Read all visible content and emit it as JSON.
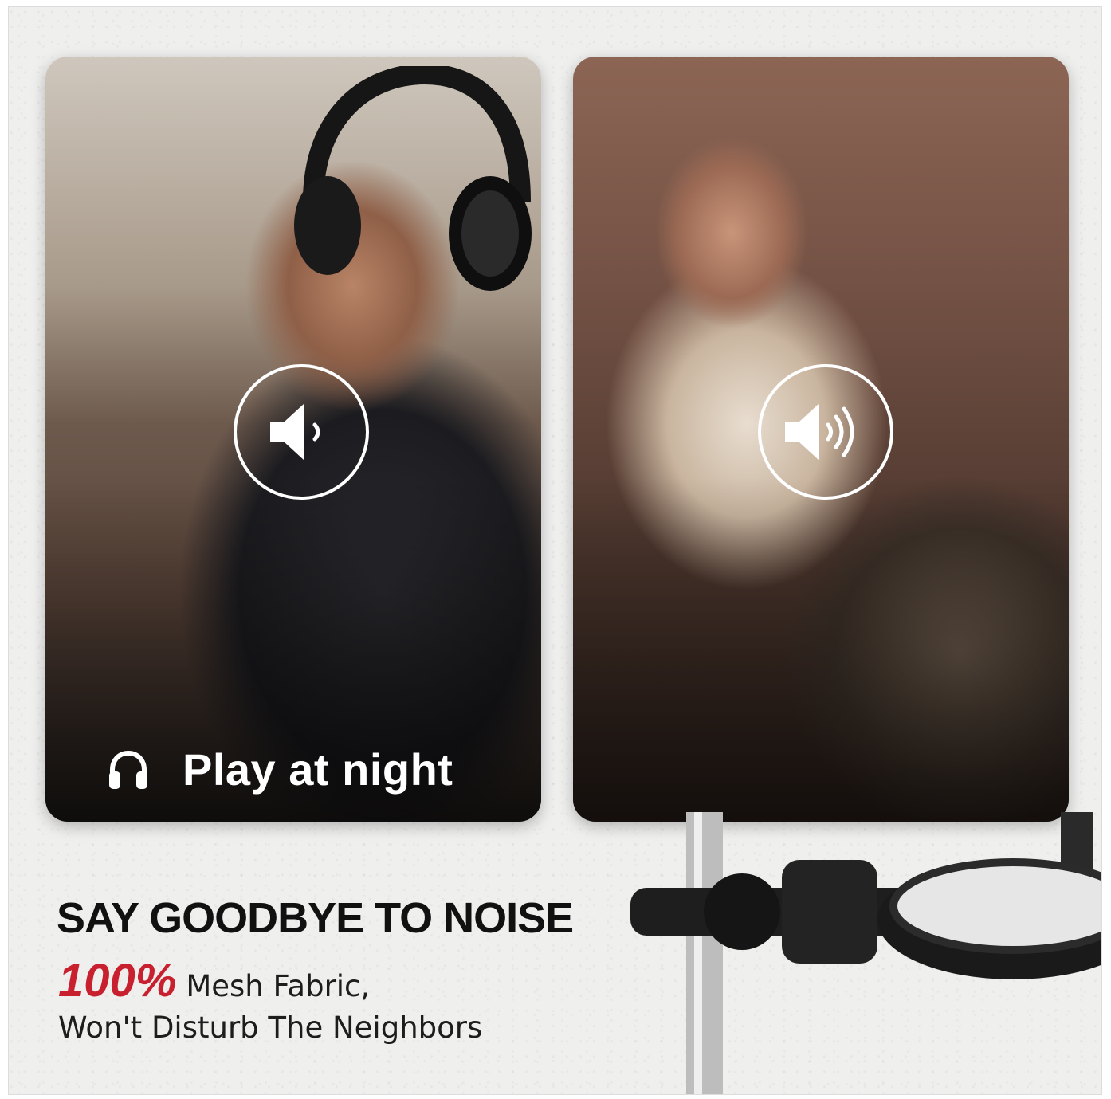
{
  "cards": {
    "left": {
      "sound_icon": "speaker-low-volume-icon",
      "label_icon": "headphones-icon",
      "label": "Play at night"
    },
    "right": {
      "sound_icon": "speaker-high-volume-icon"
    }
  },
  "text": {
    "headline": "SAY GOODBYE TO NOISE",
    "highlight": "100%",
    "line1_rest": "Mesh Fabric,",
    "line2": "Won't Disturb The Neighbors"
  },
  "colors": {
    "accent": "#c8202e",
    "headline": "#111111",
    "background": "#efefee",
    "icon": "#ffffff"
  }
}
